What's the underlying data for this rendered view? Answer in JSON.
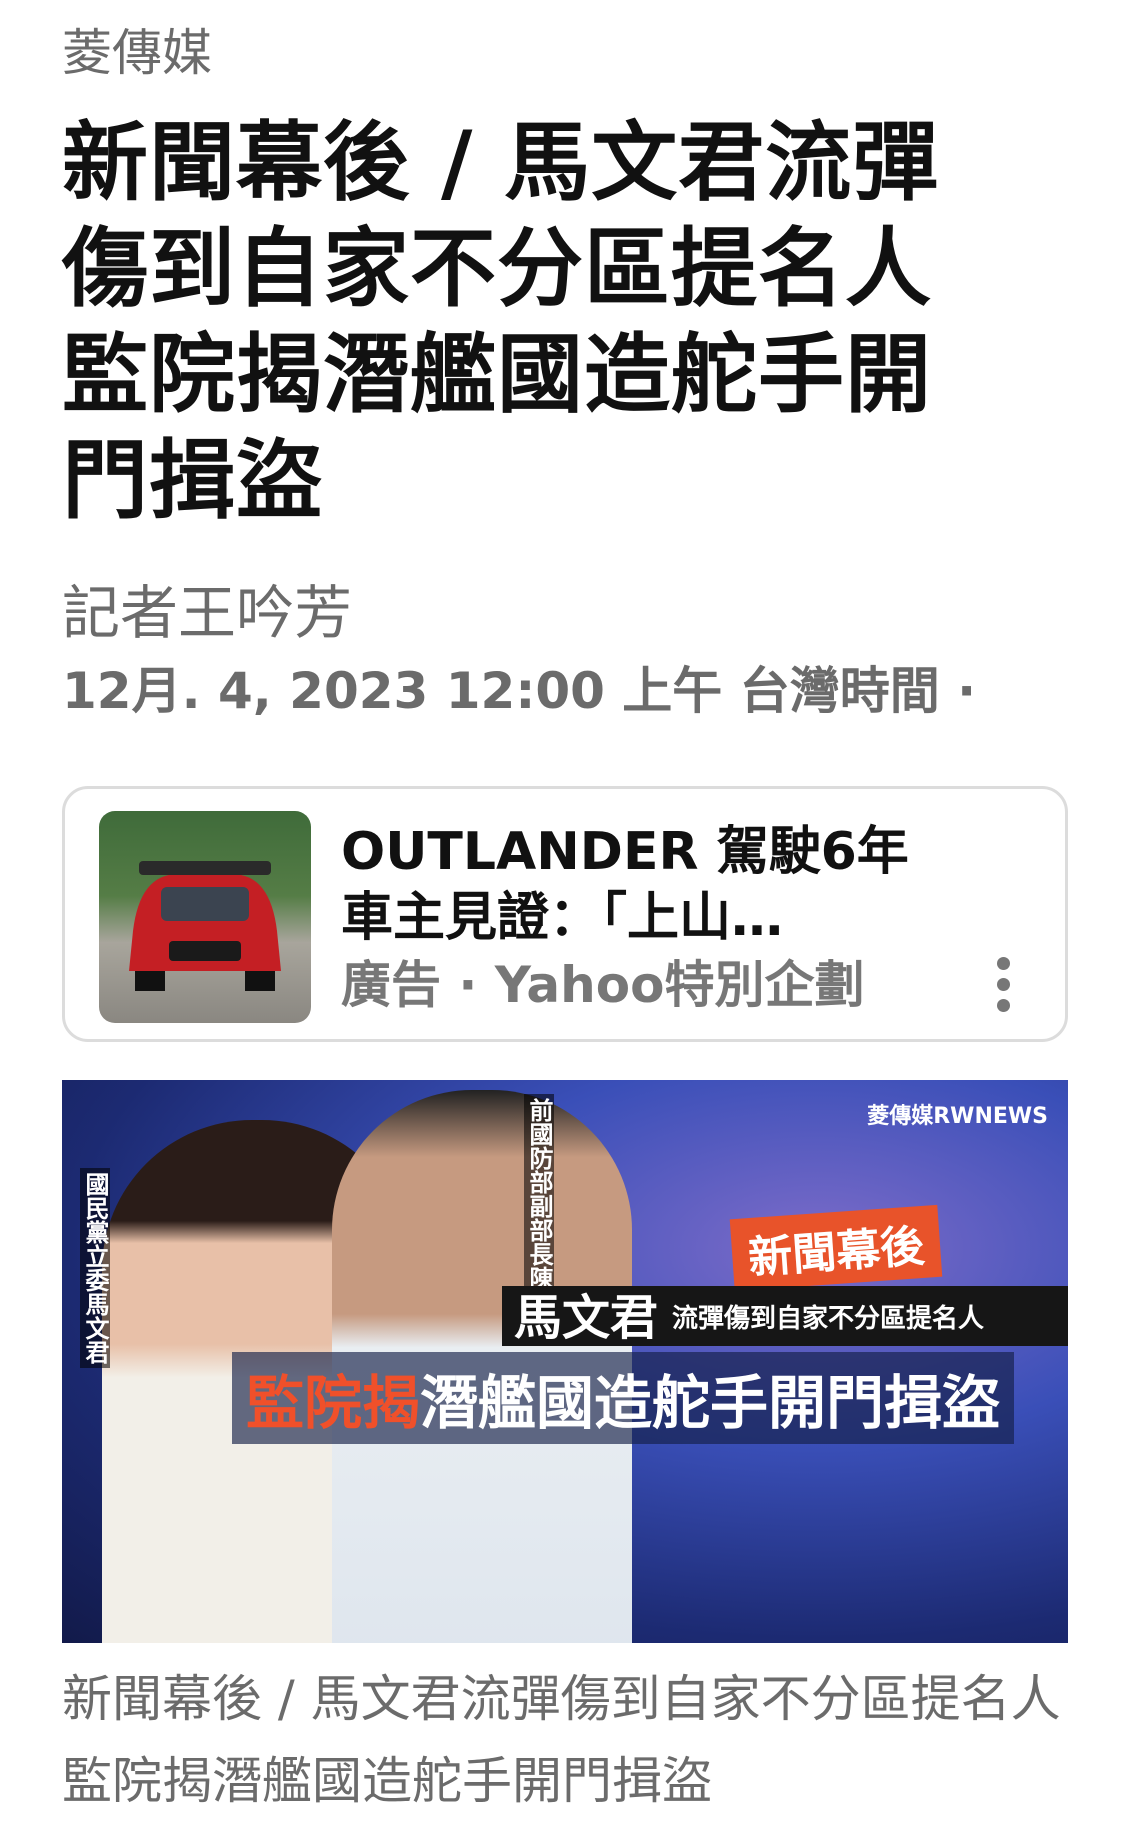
{
  "article": {
    "publisher": "菱傳媒",
    "headline": "新聞幕後 / 馬文君流彈傷到自家不分區提名人　監院揭潛艦國造舵手開門揖盜",
    "author": "記者王吟芳",
    "dateline": "12月. 4, 2023 12:00 上午 台灣時間 ·"
  },
  "ad": {
    "title": "OUTLANDER 駕駛6年車主見證：「上山…",
    "meta": "廣告 · Yahoo特別企劃",
    "more_icon": "more-vertical-icon"
  },
  "hero": {
    "logo": "菱傳媒RWNEWS",
    "label_left": "國民黨立委馬文君",
    "label_right": "前國防部副部長陳永康",
    "tag": "新聞幕後",
    "name": "馬文君",
    "subline": "流彈傷到自家不分區提名人",
    "headline_accent": "監院揭",
    "headline_rest": "潛艦國造舵手開門揖盜"
  },
  "caption": "新聞幕後 / 馬文君流彈傷到自家不分區提名人 監院揭潛艦國造舵手開門揖盜"
}
